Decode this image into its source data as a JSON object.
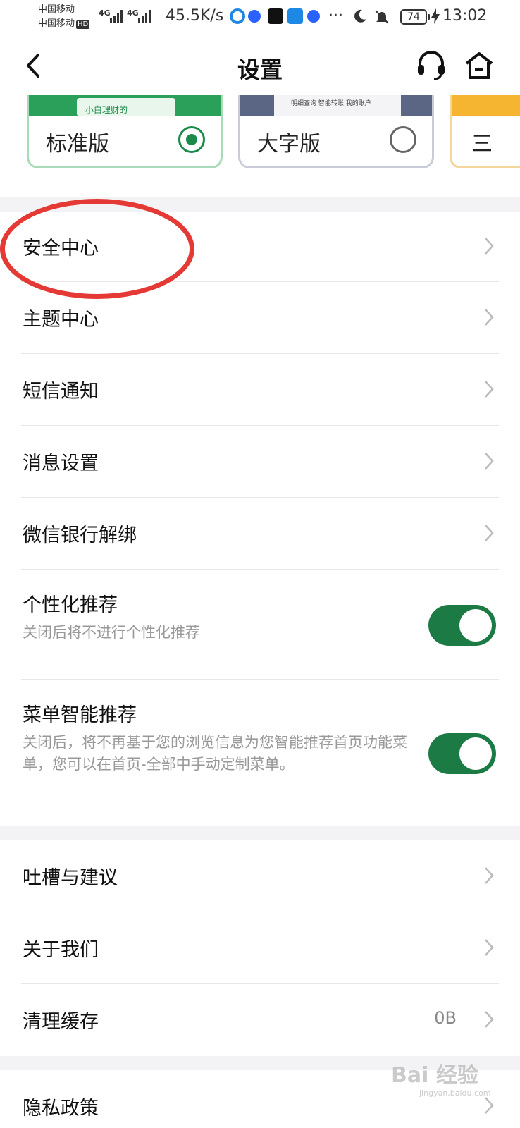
{
  "status_bar": {
    "carrier1": "中国移动",
    "carrier2": "中国移动",
    "hd": "HD",
    "net1": "4G",
    "net2": "4G",
    "speed": "45.5K/s",
    "more": "···",
    "battery": "74",
    "time": "13:02"
  },
  "header": {
    "title": "设置"
  },
  "versions": [
    {
      "label": "标准版",
      "preview_text": "小白理财的",
      "selected": true
    },
    {
      "label": "大字版",
      "preview_text": "明细查询  智能转账  我的账户",
      "selected": false
    },
    {
      "label": "三",
      "selected": false
    }
  ],
  "menu": {
    "security": "安全中心",
    "theme": "主题中心",
    "sms": "短信通知",
    "message": "消息设置",
    "wechat": "微信银行解绑",
    "personalized": {
      "label": "个性化推荐",
      "desc": "关闭后将不进行个性化推荐",
      "enabled": true
    },
    "smart_menu": {
      "label": "菜单智能推荐",
      "desc": "关闭后，将不再基于您的浏览信息为您智能推荐首页功能菜单，您可以在首页-全部中手动定制菜单。",
      "enabled": true
    },
    "feedback": "吐槽与建议",
    "about": "关于我们",
    "cache": {
      "label": "清理缓存",
      "value": "0B"
    },
    "privacy": "隐私政策"
  },
  "watermark": {
    "text": "Bai 经验",
    "sub": "jingyan.baidu.com"
  },
  "colors": {
    "accent": "#1c7a45",
    "highlight": "#e53935",
    "divider_bg": "#f3f3f5"
  }
}
